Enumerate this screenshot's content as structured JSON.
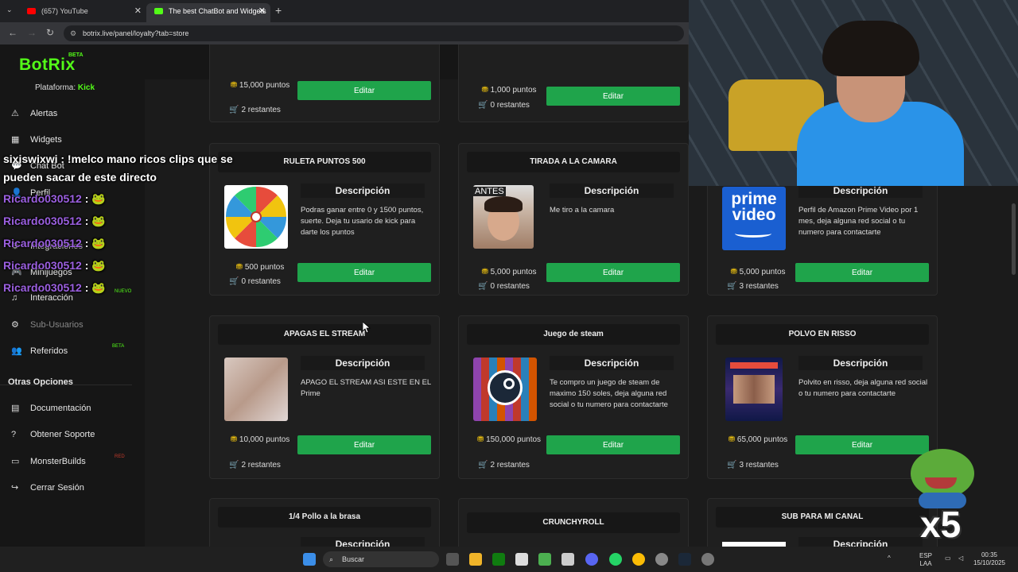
{
  "browser": {
    "tabs": [
      {
        "label": "(657) YouTube",
        "active": false,
        "fav_color": "#ff0000"
      },
      {
        "label": "The best ChatBot and Widgets",
        "active": true,
        "fav_color": "#53fc18"
      }
    ],
    "url": "botrix.live/panel/loyalty?tab=store",
    "back_icon": "←",
    "forward_icon": "→",
    "reload_icon": "↻",
    "close_icon": "✕",
    "add_tab": "+"
  },
  "app": {
    "logo": "BotRix",
    "beta": "BETA",
    "platform_label": "Plataforma: ",
    "platform_value": "Kick"
  },
  "sidebar": {
    "items": [
      {
        "label": "Alertas",
        "icon": "⚠"
      },
      {
        "label": "Widgets",
        "icon": "▦"
      },
      {
        "label": "Chat Bot",
        "icon": "💬"
      },
      {
        "label": "Perfil",
        "icon": "👤"
      },
      {
        "label": "Integraciones",
        "icon": "⚙"
      },
      {
        "label": "Minijuegos",
        "icon": "🎮"
      },
      {
        "label": "Interacción",
        "icon": "♫"
      },
      {
        "label": "Sub-Usuarios",
        "icon": "⚙"
      },
      {
        "label": "Referidos",
        "icon": "👥"
      }
    ],
    "nuevo_badge": "NUEVO",
    "beta_badge": "BETA",
    "other_header": "Otras Opciones",
    "other_items": [
      {
        "label": "Documentación",
        "icon": "▤"
      },
      {
        "label": "Obtener Soporte",
        "icon": "?"
      },
      {
        "label": "MonsterBuilds",
        "icon": "▭"
      },
      {
        "label": "Cerrar Sesión",
        "icon": "↪"
      }
    ],
    "red_badge": "RED"
  },
  "store": {
    "edit_label": "Editar",
    "desc_label": "Descripción",
    "top_cards": [
      {
        "points": "15,000 puntos",
        "remaining": "2 restantes"
      },
      {
        "points": "1,000 puntos",
        "remaining": "0 restantes"
      }
    ],
    "cards": [
      {
        "title": "RULETA PUNTOS 500",
        "desc": "Podras ganar entre 0 y 1500 puntos, suerte. Deja tu usario de kick para darte los puntos",
        "points": "500 puntos",
        "remaining": "0 restantes",
        "thumb": "wheel"
      },
      {
        "title": "TIRADA A LA CAMARA",
        "desc": "Me tiro a la camara",
        "points": "5,000 puntos",
        "remaining": "0 restantes",
        "thumb": "face",
        "thumb_text": "ANTES"
      },
      {
        "title": "",
        "desc": "Perfil de Amazon Prime Video por 1 mes, deja alguna red social o tu numero para contactarte",
        "points": "5,000 puntos",
        "remaining": "3 restantes",
        "thumb": "prime",
        "thumb_text": "prime video"
      },
      {
        "title": "APAGAS EL STREAM",
        "desc": "APAGO EL STREAM ASI ESTE EN EL Prime",
        "points": "10,000 puntos",
        "remaining": "2 restantes",
        "thumb": "photo"
      },
      {
        "title": "Juego de steam",
        "desc": "Te compro un juego de steam de maximo 150 soles, deja alguna red social o tu numero para contactarte",
        "points": "150,000 puntos",
        "remaining": "2 restantes",
        "thumb": "steam"
      },
      {
        "title": "POLVO EN RISSO",
        "desc": "Polvito en risso, deja alguna red social o tu numero para contactarte",
        "points": "65,000 puntos",
        "remaining": "3 restantes",
        "thumb": "poster"
      },
      {
        "title": "1/4 Pollo a la brasa"
      },
      {
        "title": "CRUNCHYROLL"
      },
      {
        "title": "SUB PARA MI CANAL"
      }
    ]
  },
  "chat_overlay": {
    "first_user": "sixiswixwi",
    "first_msg": " : !melco mano ricos clips que se",
    "first_msg2": "pueden sacar de este directo",
    "repeat_user": "Ricardo030512",
    "repeat_sep": " : "
  },
  "overlay": {
    "multiplier": "x5"
  },
  "taskbar": {
    "search_placeholder": "Buscar",
    "lang": "ESP",
    "lang2": "LAA",
    "time": "00:35",
    "date": "15/10/2025"
  },
  "colors": {
    "brand": "#53fc18",
    "edit_button": "#1fa44b",
    "points_coin": "#f1c40f"
  }
}
